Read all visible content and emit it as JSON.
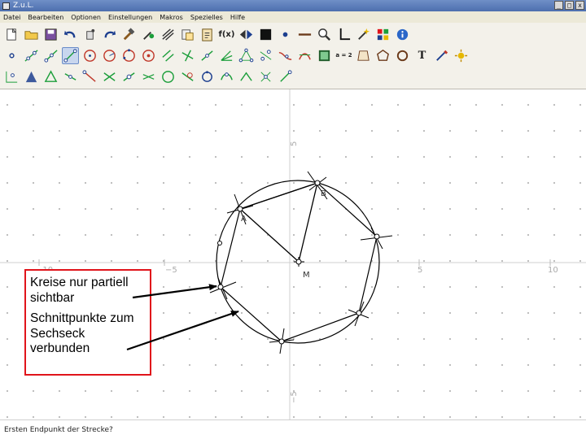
{
  "window": {
    "title": "Z.u.L.",
    "buttons": {
      "minimize": "_",
      "maximize": "□",
      "close": "x"
    }
  },
  "menu": {
    "items": [
      "Datei",
      "Bearbeiten",
      "Optionen",
      "Einstellungen",
      "Makros",
      "Spezielles",
      "Hilfe"
    ]
  },
  "toolbar": {
    "function_label": "f(x)",
    "assign_label": "a = 2",
    "text_tool_label": "T"
  },
  "canvas": {
    "axis_labels": {
      "x_minus_10": "−10",
      "x_minus_5": "−5",
      "x_plus_5": "5",
      "x_plus_10": "10",
      "y_plus_5": "5",
      "y_minus_5": "−5"
    },
    "point_labels": {
      "a": "A",
      "b": "B",
      "m": "M"
    }
  },
  "annotation": {
    "line1": "Kreise nur partiell sichtbar",
    "line2": "Schnittpunkte zum Sechseck verbunden",
    "color": "#e0141b"
  },
  "status": {
    "text": "Ersten Endpunkt der Strecke?"
  }
}
